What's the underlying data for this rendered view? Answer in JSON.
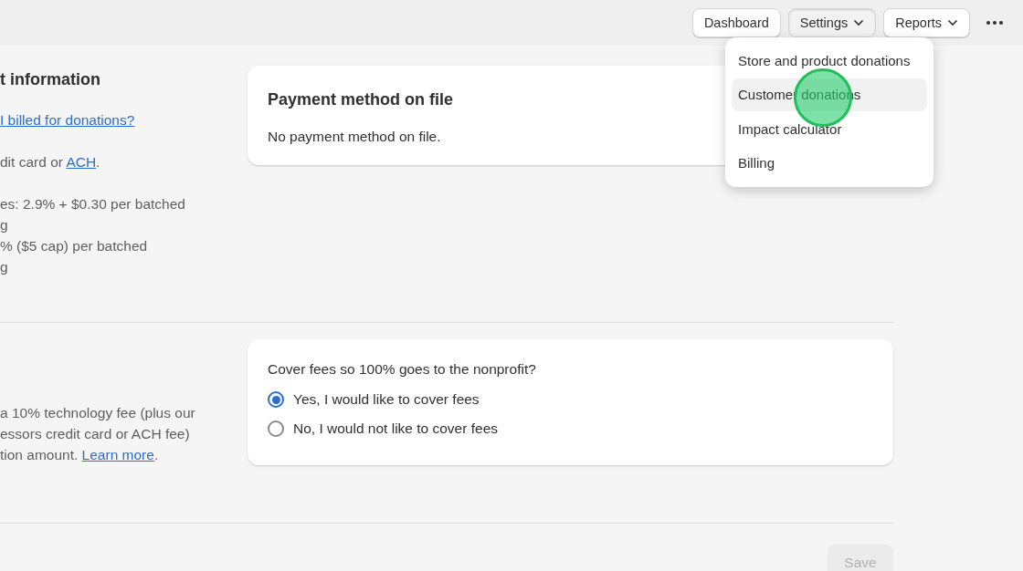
{
  "nav": {
    "items": [
      {
        "label": "Dashboard",
        "kind": "button",
        "selected": false
      },
      {
        "label": "Settings",
        "kind": "dropdown",
        "selected": true
      },
      {
        "label": "Reports",
        "kind": "dropdown",
        "selected": false
      }
    ]
  },
  "menu": {
    "items": [
      {
        "label": "Store and product donations",
        "selected": false
      },
      {
        "label": "Customer donations",
        "selected": true
      },
      {
        "label": "Impact calculator",
        "selected": false
      },
      {
        "label": "Billing",
        "selected": false
      }
    ]
  },
  "sections": [
    {
      "heading": "t information",
      "paragraphs": [
        [
          [
            {
              "text": "I billed for donations?",
              "link": true
            }
          ]
        ],
        [
          [
            {
              "text": "dit card or ",
              "link": false
            },
            {
              "text": "ACH",
              "link": true
            },
            {
              "text": ".",
              "link": false
            }
          ]
        ],
        [
          [
            {
              "text": "es: 2.9% + $0.30 per batched",
              "link": false
            }
          ],
          [
            {
              "text": "g",
              "link": false
            }
          ],
          [
            {
              "text": "% ($5 cap) per batched",
              "link": false
            }
          ],
          [
            {
              "text": "g",
              "link": false
            }
          ]
        ]
      ],
      "card": {
        "kind": "info",
        "title": "Payment method on file",
        "body": "No payment method on file."
      }
    },
    {
      "paragraphs": [
        [
          [
            {
              "text": "a 10% technology fee (plus our",
              "link": false
            }
          ],
          [
            {
              "text": "essors credit card or ACH fee)",
              "link": false
            }
          ],
          [
            {
              "text": "tion amount. ",
              "link": false
            },
            {
              "text": "Learn more",
              "link": true
            },
            {
              "text": ".",
              "link": false
            }
          ]
        ]
      ],
      "card": {
        "kind": "choice",
        "title": "Cover fees so 100% goes to the nonprofit?",
        "options": [
          {
            "label": "Yes, I would like to cover fees",
            "selected": true
          },
          {
            "label": "No, I would not like to cover fees",
            "selected": false
          }
        ]
      }
    }
  ],
  "save": {
    "label": "Save",
    "disabled": true
  }
}
